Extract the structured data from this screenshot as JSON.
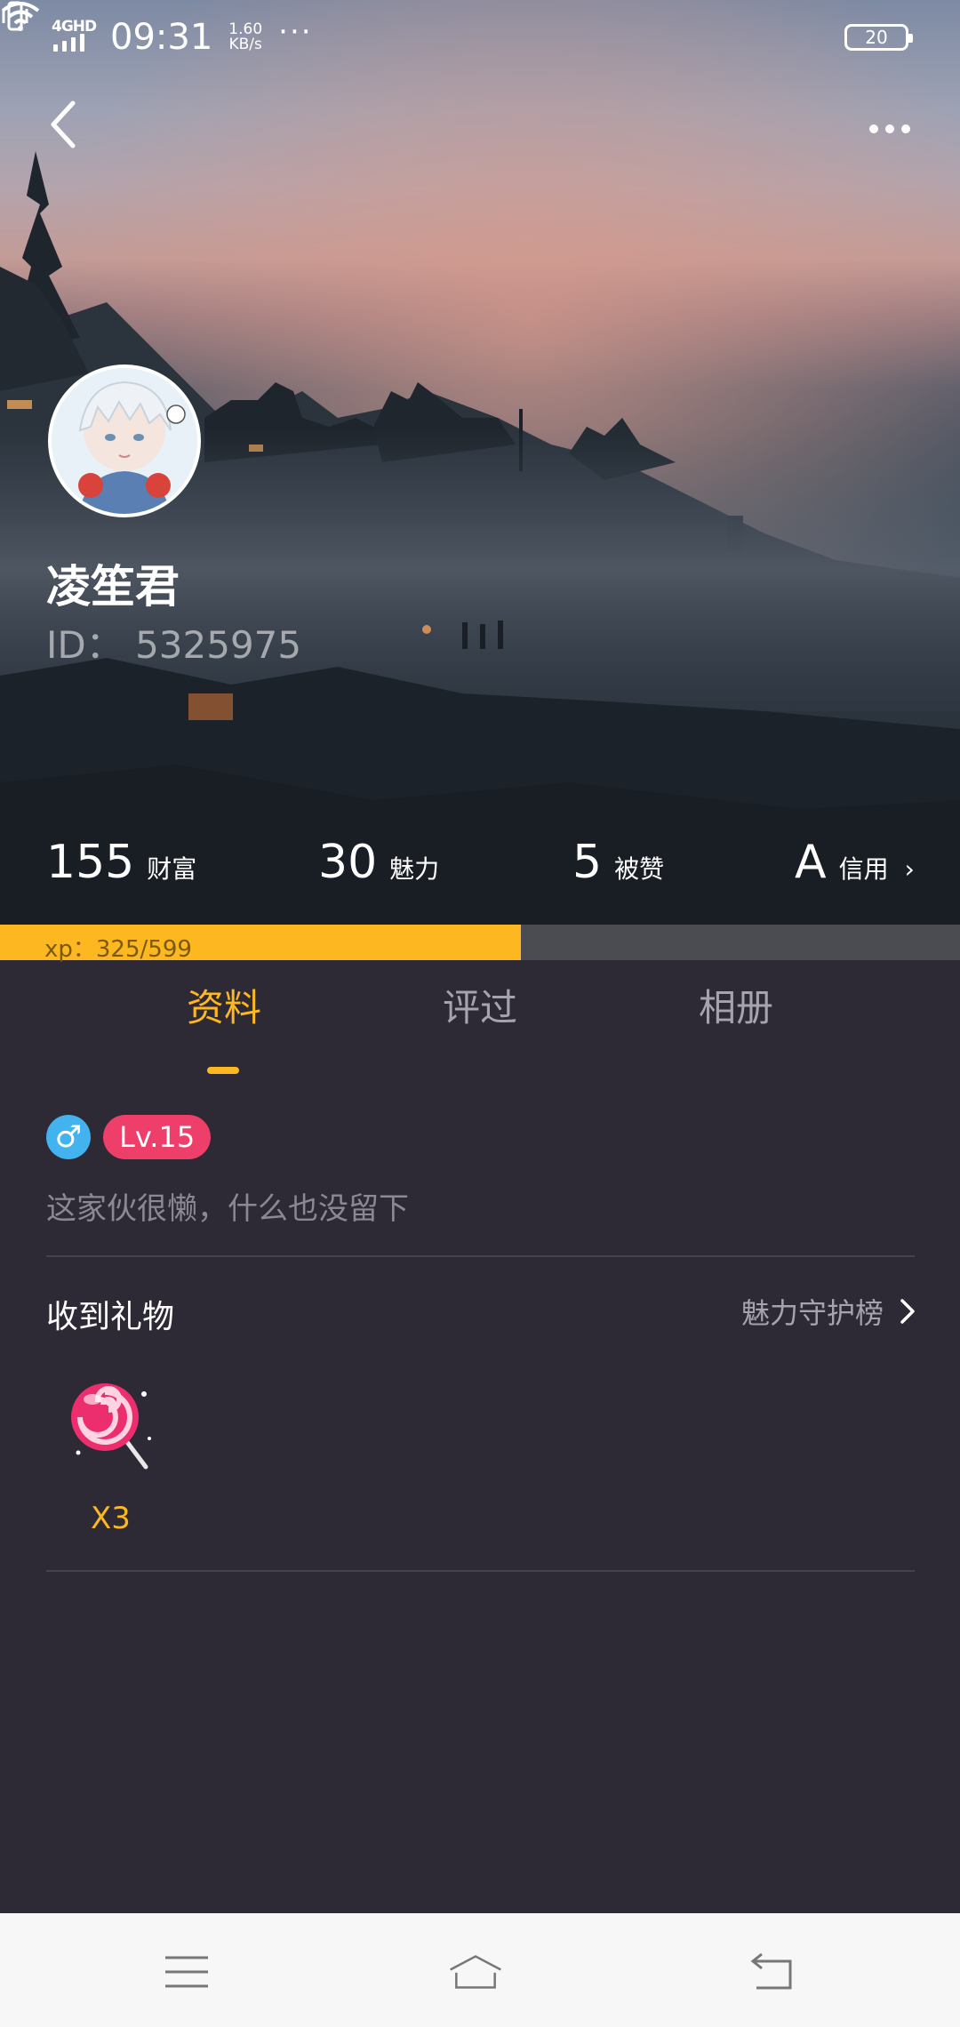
{
  "status_bar": {
    "network": "4GHD",
    "time": "09:31",
    "speed_value": "1.60",
    "speed_unit": "KB/s",
    "more": "···",
    "battery": "20"
  },
  "profile": {
    "name": "凌笙君",
    "id": "ID：  5325975"
  },
  "stats": [
    {
      "num": "155",
      "label": "财富"
    },
    {
      "num": "30",
      "label": "魅力"
    },
    {
      "num": "5",
      "label": "被赞"
    },
    {
      "num": "A",
      "label": "信用",
      "chevron": "›"
    }
  ],
  "xp": {
    "text": "xp：325/599",
    "progress": 0.5426
  },
  "tabs": [
    {
      "label": "资料",
      "active": true
    },
    {
      "label": "评过",
      "active": false
    },
    {
      "label": "相册",
      "active": false
    }
  ],
  "badges": {
    "gender_symbol": "♂",
    "level": "Lv.15"
  },
  "bio": "这家伙很懒，什么也没留下",
  "gifts": {
    "title": "收到礼物",
    "link": "魅力守护榜",
    "link_chevron": "›",
    "items": [
      {
        "icon": "lollipop-icon",
        "count": "X3"
      }
    ]
  },
  "colors": {
    "accent": "#fdb720",
    "background": "#2d2a35",
    "level_badge": "#ee3e6a",
    "gender_badge": "#43b3f0"
  }
}
